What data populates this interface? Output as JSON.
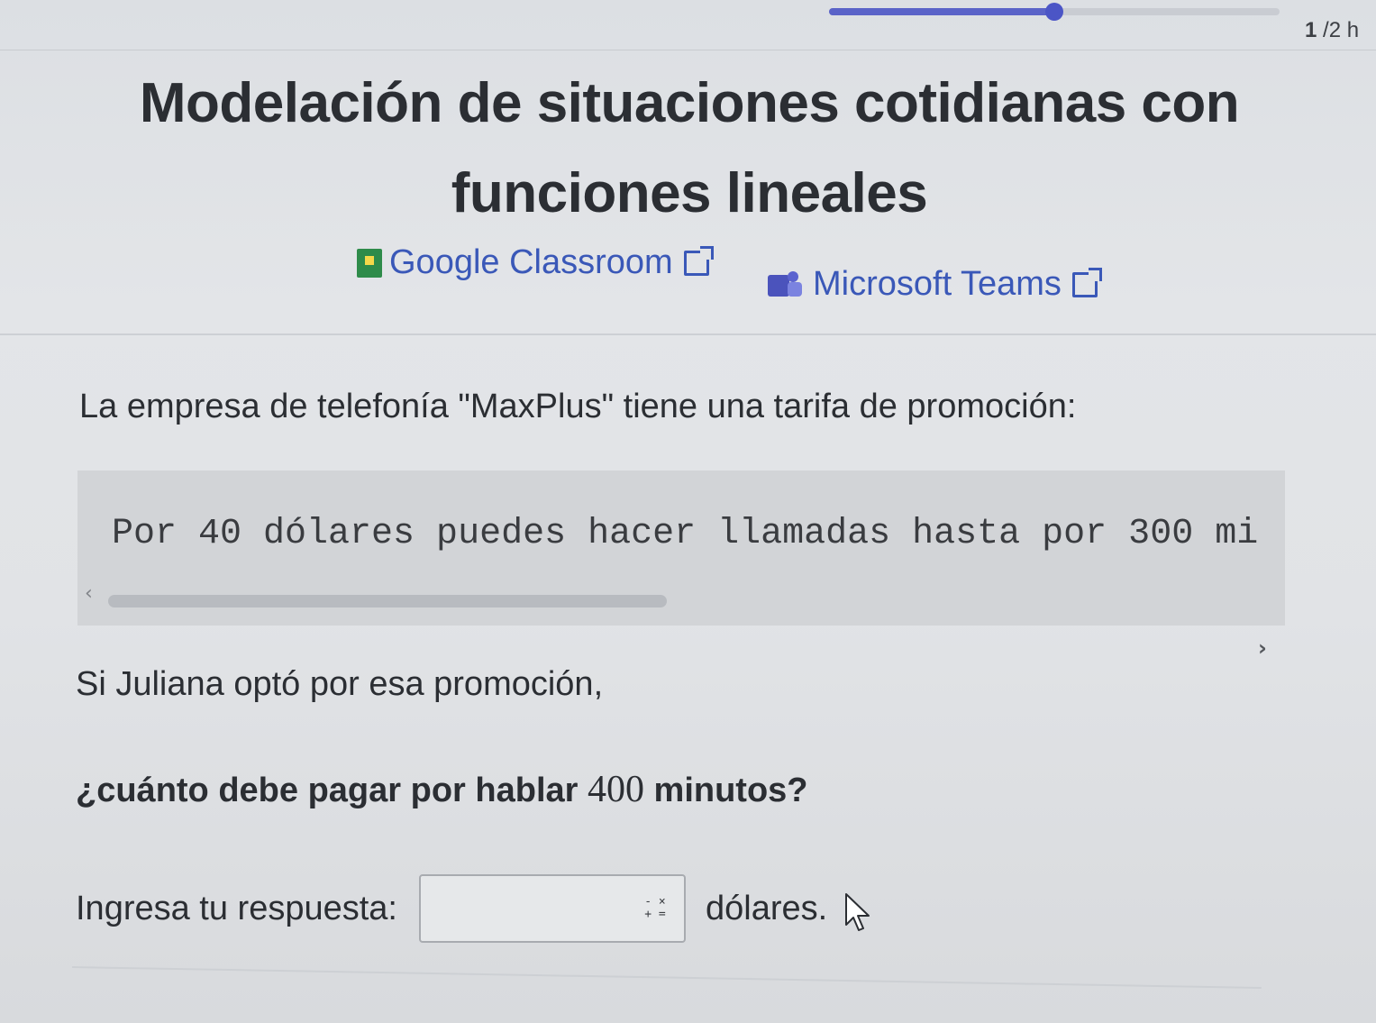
{
  "progress": {
    "fraction": 0.5,
    "page_current": "1",
    "page_rest": " /2 h"
  },
  "title": "Modelación de situaciones cotidianas con funciones lineales",
  "share": {
    "google_classroom": "Google Classroom",
    "microsoft_teams": "Microsoft Teams"
  },
  "problem": {
    "intro": "La empresa de telefonía \"MaxPlus\" tiene una tarifa de promoción:",
    "code": "Por 40 dólares puedes hacer llamadas hasta por 300 mi",
    "line1": "Si Juliana optó por esa promoción,",
    "question_before": "¿cuánto debe pagar por hablar ",
    "question_number": "400",
    "question_after": " minutos?"
  },
  "answer": {
    "label": "Ingresa tu respuesta:",
    "value": "",
    "placeholder": "",
    "unit": "dólares.",
    "math_keyboard_top": "- ×",
    "math_keyboard_bottom": "+ ="
  },
  "icons": {
    "google_classroom": "google-classroom-icon",
    "microsoft_teams": "microsoft-teams-icon",
    "external_link": "external-link-icon",
    "math_keyboard": "math-keyboard-icon",
    "pointer": "mouse-pointer-icon",
    "scroll_left": "chevron-left-icon",
    "scroll_right": "chevron-right-icon"
  },
  "colors": {
    "accent": "#4b55c6",
    "link": "#3a58b8"
  }
}
